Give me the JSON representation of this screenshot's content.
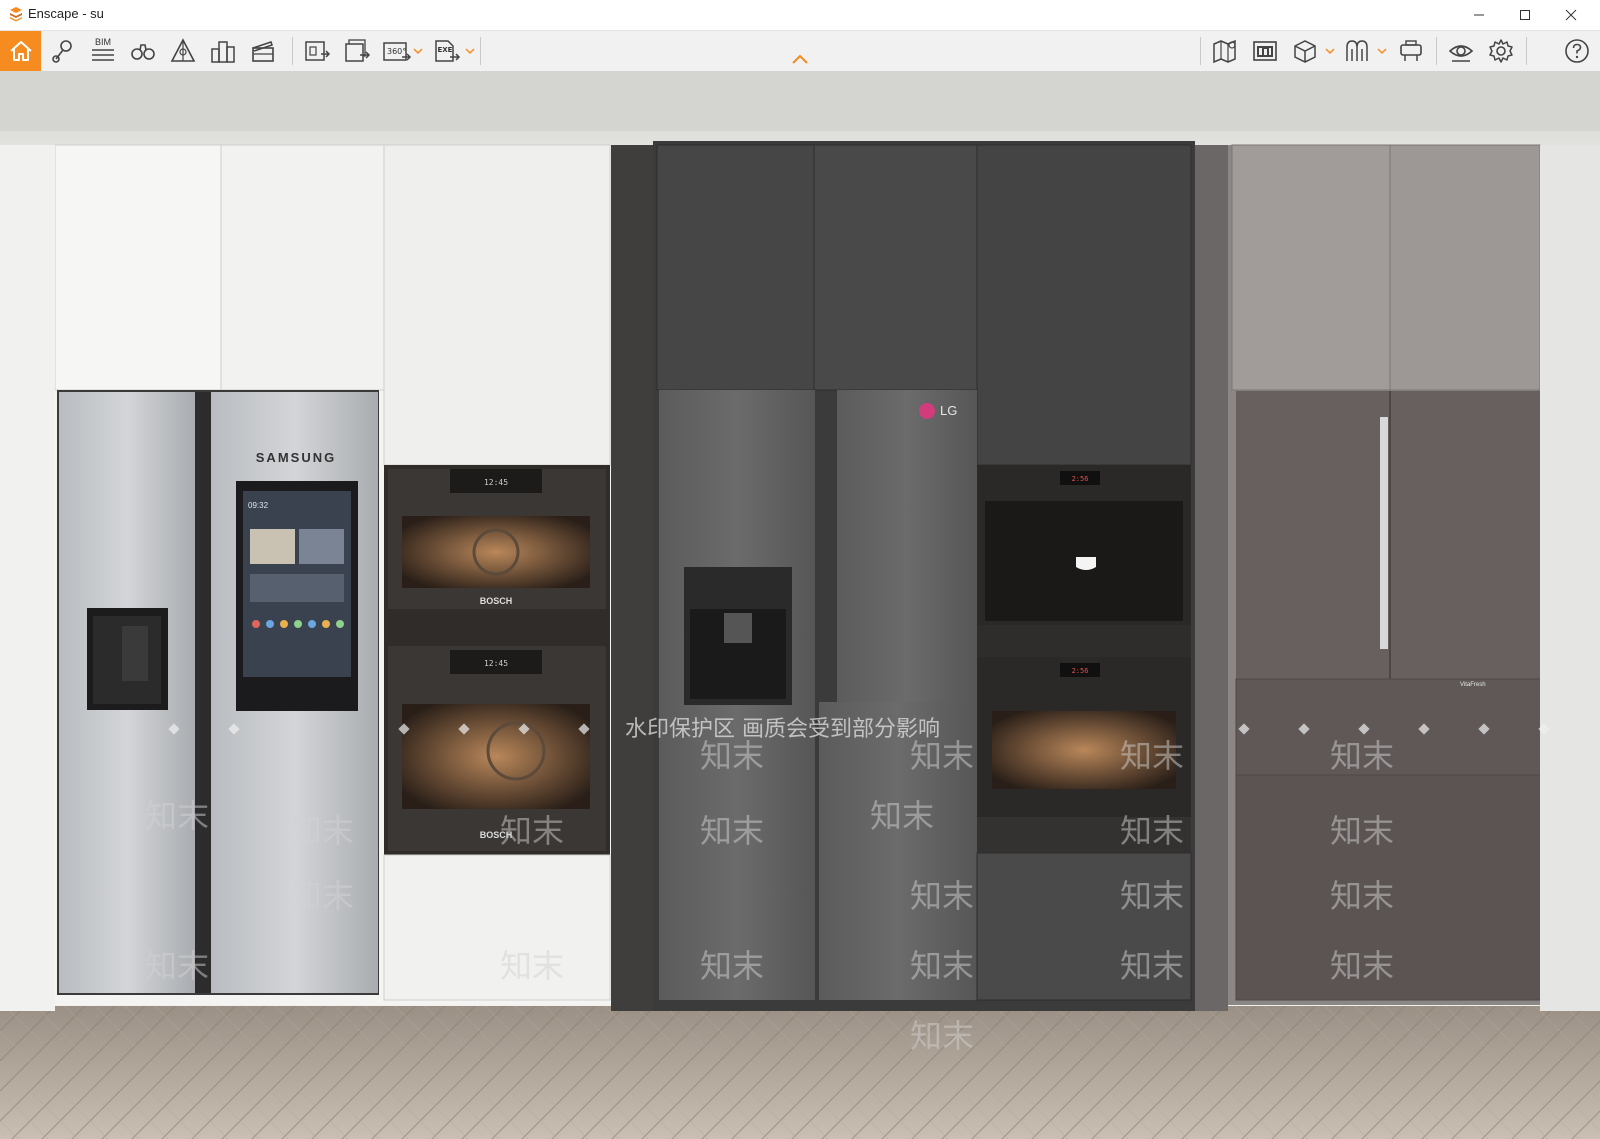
{
  "window": {
    "title": "Enscape - su",
    "controls": [
      "minimize",
      "maximize",
      "close"
    ]
  },
  "toolbar": {
    "left_tools": [
      {
        "name": "home-icon",
        "active": true
      },
      {
        "name": "location-pin-icon"
      },
      {
        "name": "bim-icon",
        "label": "BIM"
      },
      {
        "name": "binoculars-icon"
      },
      {
        "name": "section-triangle-icon"
      },
      {
        "name": "buildings-icon"
      },
      {
        "name": "clapperboard-icon"
      },
      {
        "name": "render-export-icon"
      },
      {
        "name": "batch-render-icon"
      },
      {
        "name": "panorama-360-icon",
        "label": "360°",
        "has_dropdown": true
      },
      {
        "name": "export-exe-icon",
        "label": "EXE",
        "has_dropdown": true
      }
    ],
    "right_tools": [
      {
        "name": "map-icon"
      },
      {
        "name": "asset-library-icon"
      },
      {
        "name": "cube-icon",
        "has_dropdown": true
      },
      {
        "name": "material-icon",
        "has_dropdown": true
      },
      {
        "name": "vr-headset-icon"
      },
      {
        "name": "eye-icon"
      },
      {
        "name": "gear-icon"
      },
      {
        "name": "help-icon"
      }
    ],
    "accent_color": "#f68b1f"
  },
  "viewport": {
    "brands": {
      "samsung": "SAMSUNG",
      "bosch_1": "BOSCH",
      "bosch_2": "BOSCH",
      "lg": "LG",
      "vitafresh": "VitaFresh"
    },
    "watermark_text": "水印保护区  画质会受到部分影响",
    "watermark_logo": "知末",
    "oven_displays": [
      "12:45",
      "12:45"
    ],
    "coffee_displays": [
      "2:56",
      "2:56"
    ],
    "fridge_screen_time": "09:32"
  }
}
